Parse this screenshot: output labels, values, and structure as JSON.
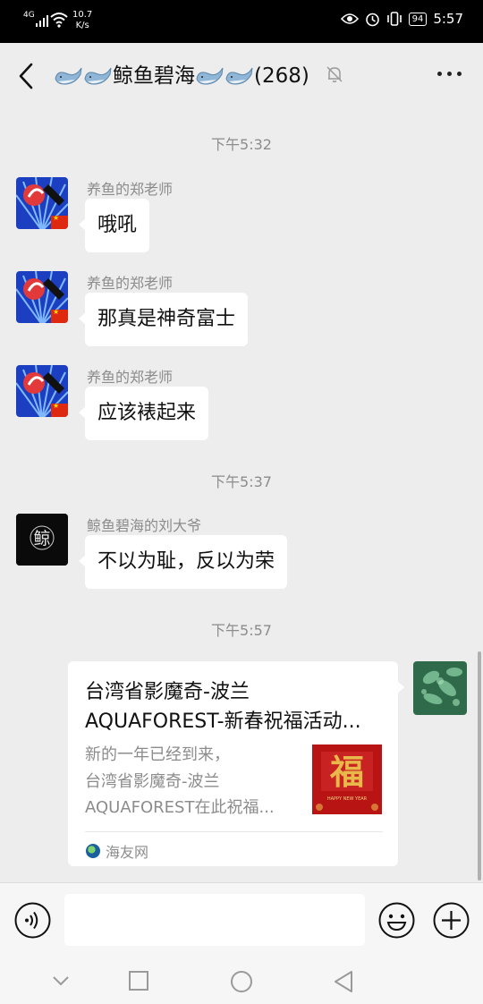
{
  "status_bar": {
    "network": "4G",
    "speed_value": "10.7",
    "speed_unit": "K/s",
    "battery": "94",
    "time": "5:57"
  },
  "header": {
    "title": "鲸鱼碧海",
    "member_count": "(268)"
  },
  "messages": [
    {
      "type": "timestamp",
      "text": "下午5:32"
    },
    {
      "type": "text",
      "sender": "养鱼的郑老师",
      "text": "哦吼"
    },
    {
      "type": "text",
      "sender": "养鱼的郑老师",
      "text": "那真是神奇富士"
    },
    {
      "type": "text",
      "sender": "养鱼的郑老师",
      "text": "应该裱起来"
    },
    {
      "type": "timestamp",
      "text": "下午5:37"
    },
    {
      "type": "text",
      "sender": "鲸鱼碧海的刘大爷",
      "avatar_char": "鲸",
      "text": "不以为耻，反以为荣"
    },
    {
      "type": "timestamp",
      "text": "下午5:57"
    }
  ],
  "link_card": {
    "title_line1": "台湾省影魔奇-波兰",
    "title_line2": "AQUAFOREST-新春祝福活动...",
    "desc_line1": "新的一年已经到来，",
    "desc_line2": "台湾省影魔奇-波兰",
    "desc_line3": "AQUAFOREST在此祝福...",
    "thumb_char": "福",
    "thumb_caption": "HAPPY NEW YEAR",
    "source": "海友网"
  },
  "colors": {
    "background": "#ededed",
    "bubble": "#ffffff",
    "meta_text": "#8c8c8c",
    "status_bar": "#000000"
  }
}
